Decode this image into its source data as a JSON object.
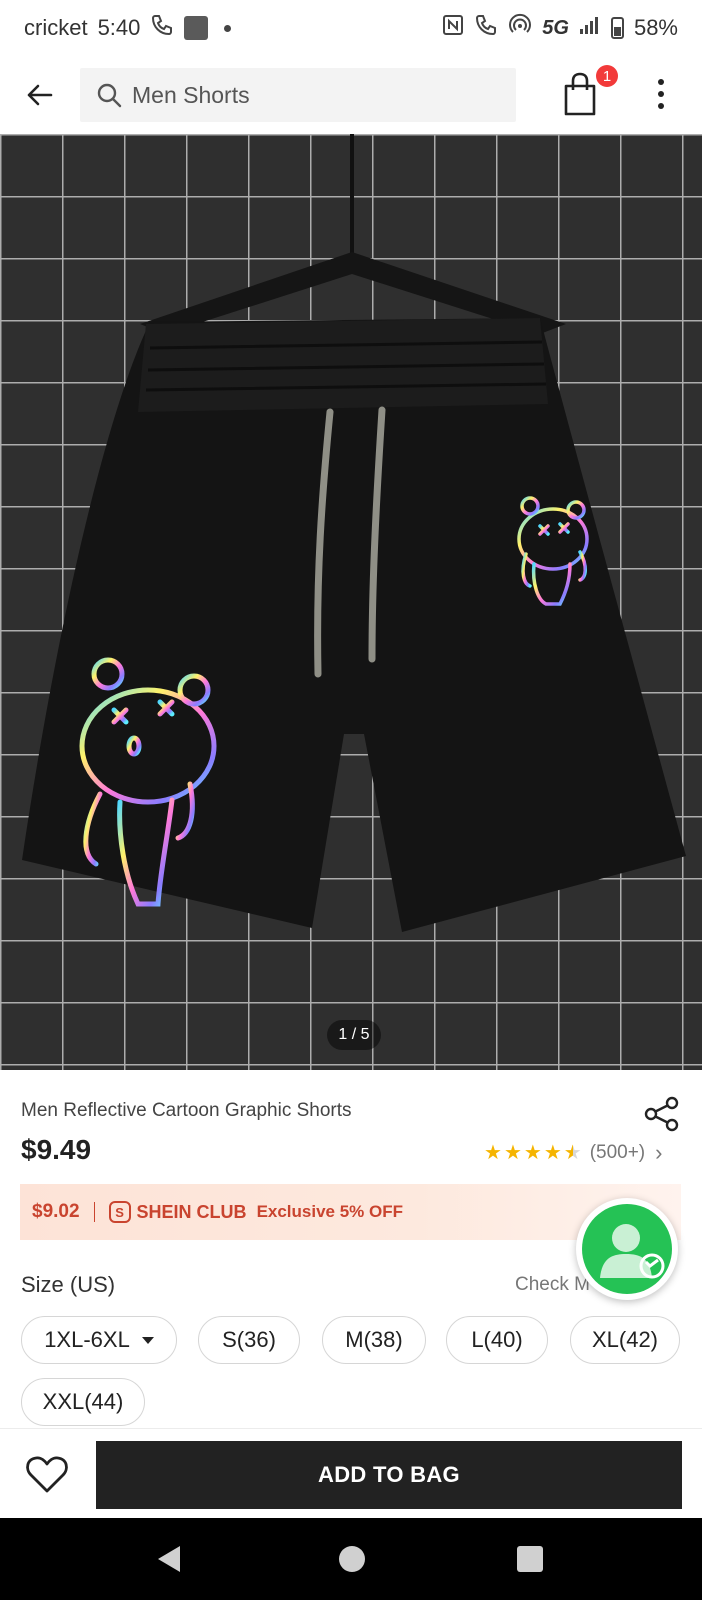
{
  "status_bar": {
    "carrier": "cricket",
    "time": "5:40",
    "network": "5G",
    "battery": "58%"
  },
  "app_bar": {
    "search_text": "Men Shorts",
    "cart_count": "1"
  },
  "hero": {
    "image_counter": "1 / 5"
  },
  "product": {
    "title": "Men Reflective Cartoon Graphic Shorts",
    "price": "$9.49",
    "rating_count": "(500+)",
    "rating_value": 4.5
  },
  "club": {
    "price": "$9.02",
    "name": "SHEIN CLUB",
    "offer": "Exclusive 5% OFF"
  },
  "size": {
    "label": "Size (US)",
    "check_link": "Check M",
    "options": [
      "1XL-6XL",
      "S(36)",
      "M(38)",
      "L(40)",
      "XL(42)",
      "XXL(44)"
    ]
  },
  "actions": {
    "add_to_bag": "ADD TO BAG"
  },
  "colors": {
    "accent_red": "#f23a3a",
    "club_text": "#c9442f",
    "chat_green": "#25c255",
    "button_dark": "#222222"
  }
}
